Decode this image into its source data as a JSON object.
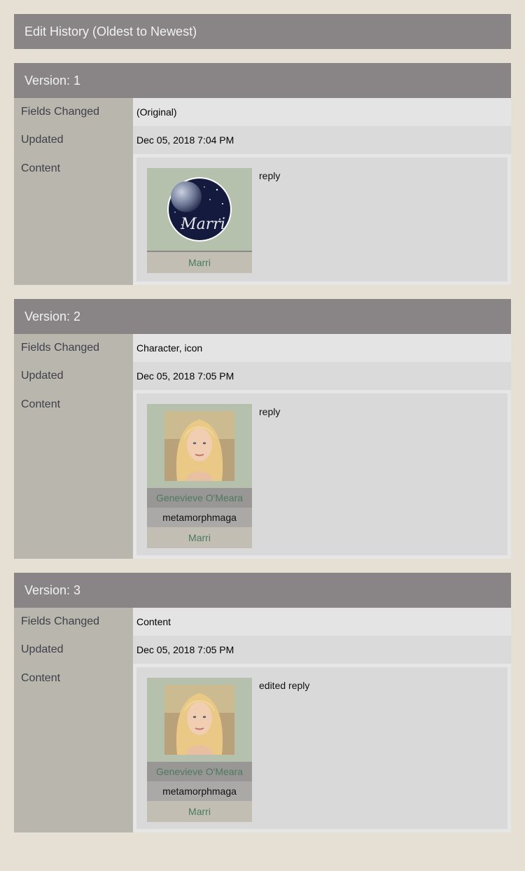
{
  "page": {
    "title": "Edit History (Oldest to Newest)",
    "labels": {
      "fields_changed": "Fields Changed",
      "updated": "Updated",
      "content": "Content"
    }
  },
  "versions": [
    {
      "heading": "Version: 1",
      "fields_changed": "(Original)",
      "updated": "Dec 05, 2018 7:04 PM",
      "content": "reply",
      "author": {
        "icon": "moon-icon",
        "icon_lettering": "Marri",
        "character": "",
        "screenname": "",
        "user": "Marri"
      }
    },
    {
      "heading": "Version: 2",
      "fields_changed": "Character, icon",
      "updated": "Dec 05, 2018 7:05 PM",
      "content": "reply",
      "author": {
        "icon": "portrait-blonde-woman",
        "character": "Genevieve O'Meara",
        "screenname": "metamorphmaga",
        "user": "Marri"
      }
    },
    {
      "heading": "Version: 3",
      "fields_changed": "Content",
      "updated": "Dec 05, 2018 7:05 PM",
      "content": "edited reply",
      "author": {
        "icon": "portrait-blonde-woman",
        "character": "Genevieve O'Meara",
        "screenname": "metamorphmaga",
        "user": "Marri"
      }
    }
  ],
  "colors": {
    "page_bg": "#e6e0d4",
    "header_bg": "#898586",
    "label_bg": "#b9b6ad",
    "link": "#4d7a5e"
  }
}
